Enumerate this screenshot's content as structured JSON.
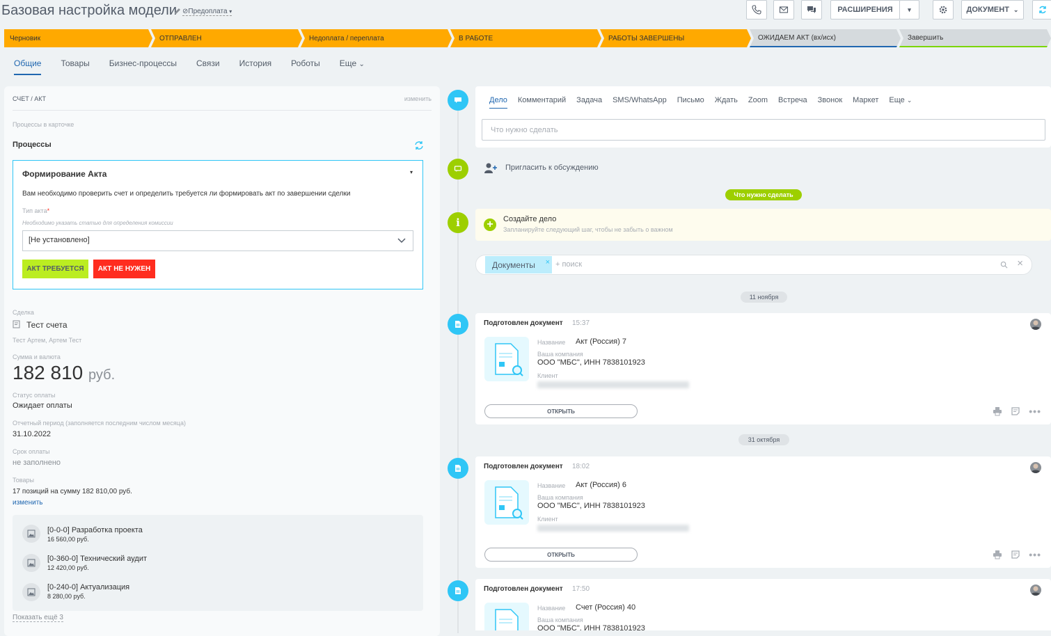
{
  "header": {
    "title": "Базовая настройка модели",
    "pipeline": "Предоплата",
    "extensions_label": "РАСШИРЕНИЯ",
    "document_label": "ДОКУМЕНТ"
  },
  "stages": [
    {
      "label": "Черновик",
      "color": "#ffa900"
    },
    {
      "label": "ОТПРАВЛЕН",
      "color": "#ffa900"
    },
    {
      "label": "Недоплата / переплата",
      "color": "#ffa900"
    },
    {
      "label": "В РАБОТЕ",
      "color": "#ffa900"
    },
    {
      "label": "РАБОТЫ ЗАВЕРШЕНЫ",
      "color": "#ffa900"
    },
    {
      "label": "ОЖИДАЕМ АКТ (вх/исх)",
      "color": "#d5dadd"
    },
    {
      "label": "Завершить",
      "color": "#d5dadd"
    }
  ],
  "tabs": [
    "Общие",
    "Товары",
    "Бизнес-процессы",
    "Связи",
    "История",
    "Роботы",
    "Еще"
  ],
  "left": {
    "section_title": "СЧЕТ / АКТ",
    "edit_link": "изменить",
    "processes_caption": "Процессы в карточке",
    "processes_title": "Процессы",
    "process": {
      "title": "Формирование Акта",
      "description": "Вам необходимо проверить счет и определить требуется ли формировать акт по завершении сделки",
      "field_label": "Тип акта",
      "field_required_mark": "*",
      "field_hint": "Необходимо указать статью для определения комиссии",
      "select_value": "[Не установлено]",
      "btn_required": "АКТ ТРЕБУЕТСЯ",
      "btn_not_needed": "АКТ НЕ НУЖЕН"
    },
    "deal_label": "Сделка",
    "deal_value": "Тест счета",
    "deal_contacts": "Тест Артем, Артем Тест",
    "sum_label": "Сумма и валюта",
    "sum_value": "182 810",
    "sum_currency": "руб.",
    "pay_status_label": "Статус оплаты",
    "pay_status_value": "Ожидает оплаты",
    "period_label": "Отчетный период (заполняется последним числом месяца)",
    "period_value": "31.10.2022",
    "due_label": "Срок оплаты",
    "due_value": "не заполнено",
    "goods_label": "Товары",
    "goods_summary": "17 позиций на сумму 182 810,00 руб.",
    "goods_edit": "изменить",
    "products": [
      {
        "name": "[0-0-0] Разработка проекта",
        "price": "16 560,00 руб."
      },
      {
        "name": "[0-360-0] Технический аудит",
        "price": "12 420,00 руб."
      },
      {
        "name": "[0-240-0] Актуализация",
        "price": "8 280,00 руб."
      }
    ],
    "show_more": "Показать ещё 3"
  },
  "timeline": {
    "activity_tabs": [
      "Дело",
      "Комментарий",
      "Задача",
      "SMS/WhatsApp",
      "Письмо",
      "Ждать",
      "Zoom",
      "Встреча",
      "Звонок",
      "Маркет",
      "Еще"
    ],
    "todo_placeholder": "Что нужно сделать",
    "invite_label": "Пригласить к обсуждению",
    "todo_pill": "Что нужно сделать",
    "create_title": "Создайте дело",
    "create_sub": "Запланируйте следующий шаг, чтобы не забыть о важном",
    "filter_tag": "Документы",
    "search_placeholder": "+ поиск",
    "date1": "11 ноября",
    "date2": "31 октября",
    "name_label": "Название",
    "company_label": "Ваша компания",
    "client_label": "Клиент",
    "open_label": "ОТКРЫТЬ",
    "docs": [
      {
        "title": "Подготовлен документ",
        "time": "15:37",
        "name": "Акт (Россия) 7",
        "company": "ООО \"МБС\", ИНН 7838101923"
      },
      {
        "title": "Подготовлен документ",
        "time": "18:02",
        "name": "Акт (Россия) 6",
        "company": "ООО \"МБС\", ИНН 7838101923"
      },
      {
        "title": "Подготовлен документ",
        "time": "17:50",
        "name": "Счет (Россия) 40",
        "company": "ООО \"МБС\", ИНН 7838101923"
      }
    ]
  },
  "colors": {
    "accent": "#2067b0",
    "stage_active": "#ffa900",
    "timeline_blue": "#2fc6f6",
    "timeline_green": "#9dcf00",
    "btn_green": "#bbed21",
    "btn_red": "#ff2d1f"
  }
}
